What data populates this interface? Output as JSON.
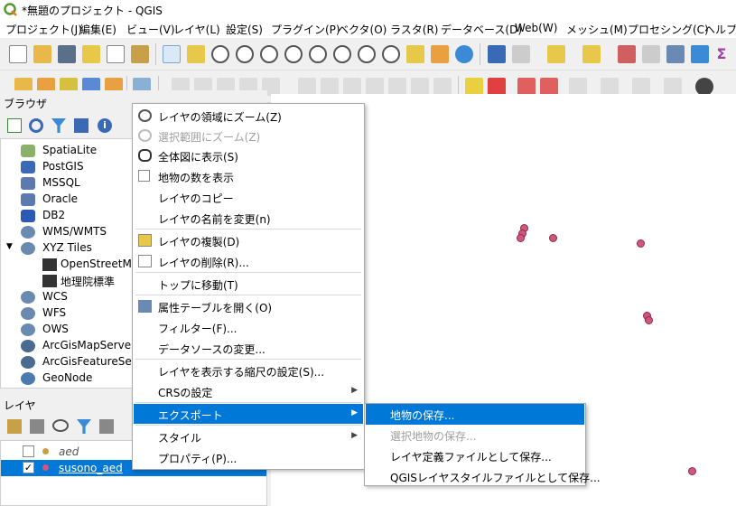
{
  "window": {
    "title": "*無題のプロジェクト - QGIS"
  },
  "menubar": {
    "items": [
      "プロジェクト(J)",
      "編集(E)",
      "ビュー(V)",
      "レイヤ(L)",
      "設定(S)",
      "プラグイン(P)",
      "ベクタ(O)",
      "ラスタ(R)",
      "データベース(D)",
      "Web(W)",
      "メッシュ(M)",
      "プロセシング(C)",
      "ヘルプ(H)"
    ]
  },
  "browser": {
    "title": "ブラウザ",
    "items": [
      {
        "label": "SpatiaLite",
        "icon": "feather-icon"
      },
      {
        "label": "PostGIS",
        "icon": "elephant-icon"
      },
      {
        "label": "MSSQL",
        "icon": "database-icon"
      },
      {
        "label": "Oracle",
        "icon": "database-icon"
      },
      {
        "label": "DB2",
        "icon": "db2-icon"
      },
      {
        "label": "WMS/WMTS",
        "icon": "globe-icon"
      },
      {
        "label": "XYZ Tiles",
        "icon": "globe-icon"
      },
      {
        "label": "OpenStreetMap",
        "icon": "tiles-icon"
      },
      {
        "label": "地理院標準",
        "icon": "tiles-icon"
      },
      {
        "label": "WCS",
        "icon": "globe-icon"
      },
      {
        "label": "WFS",
        "icon": "globe-icon"
      },
      {
        "label": "OWS",
        "icon": "globe-icon"
      },
      {
        "label": "ArcGisMapServer",
        "icon": "globe-icon"
      },
      {
        "label": "ArcGisFeatureServer",
        "icon": "globe-icon"
      },
      {
        "label": "GeoNode",
        "icon": "geonode-icon"
      }
    ]
  },
  "layers": {
    "title": "レイヤ",
    "items": [
      {
        "label": "aed",
        "checked": false
      },
      {
        "label": "susono_aed",
        "checked": true
      }
    ]
  },
  "context_menu": {
    "items": [
      {
        "label": "レイヤの領域にズーム(Z)"
      },
      {
        "label": "選択範囲にズーム(Z)"
      },
      {
        "label": "全体図に表示(S)"
      },
      {
        "label": "地物の数を表示"
      },
      {
        "label": "レイヤのコピー"
      },
      {
        "label": "レイヤの名前を変更(n)"
      },
      {
        "label": "レイヤの複製(D)"
      },
      {
        "label": "レイヤの削除(R)..."
      },
      {
        "label": "トップに移動(T)"
      },
      {
        "label": "属性テーブルを開く(O)"
      },
      {
        "label": "フィルター(F)..."
      },
      {
        "label": "データソースの変更..."
      },
      {
        "label": "レイヤを表示する縮尺の設定(S)..."
      },
      {
        "label": "CRSの設定"
      },
      {
        "label": "エクスポート"
      },
      {
        "label": "スタイル"
      },
      {
        "label": "プロパティ(P)..."
      }
    ]
  },
  "export_submenu": {
    "items": [
      {
        "label": "地物の保存..."
      },
      {
        "label": "選択地物の保存..."
      },
      {
        "label": "レイヤ定義ファイルとして保存..."
      },
      {
        "label": "QGISレイヤスタイルファイルとして保存..."
      }
    ]
  },
  "colors": {
    "accent": "#0078d7",
    "point_fill": "#d2557a",
    "point_stroke": "#8a2c48"
  }
}
